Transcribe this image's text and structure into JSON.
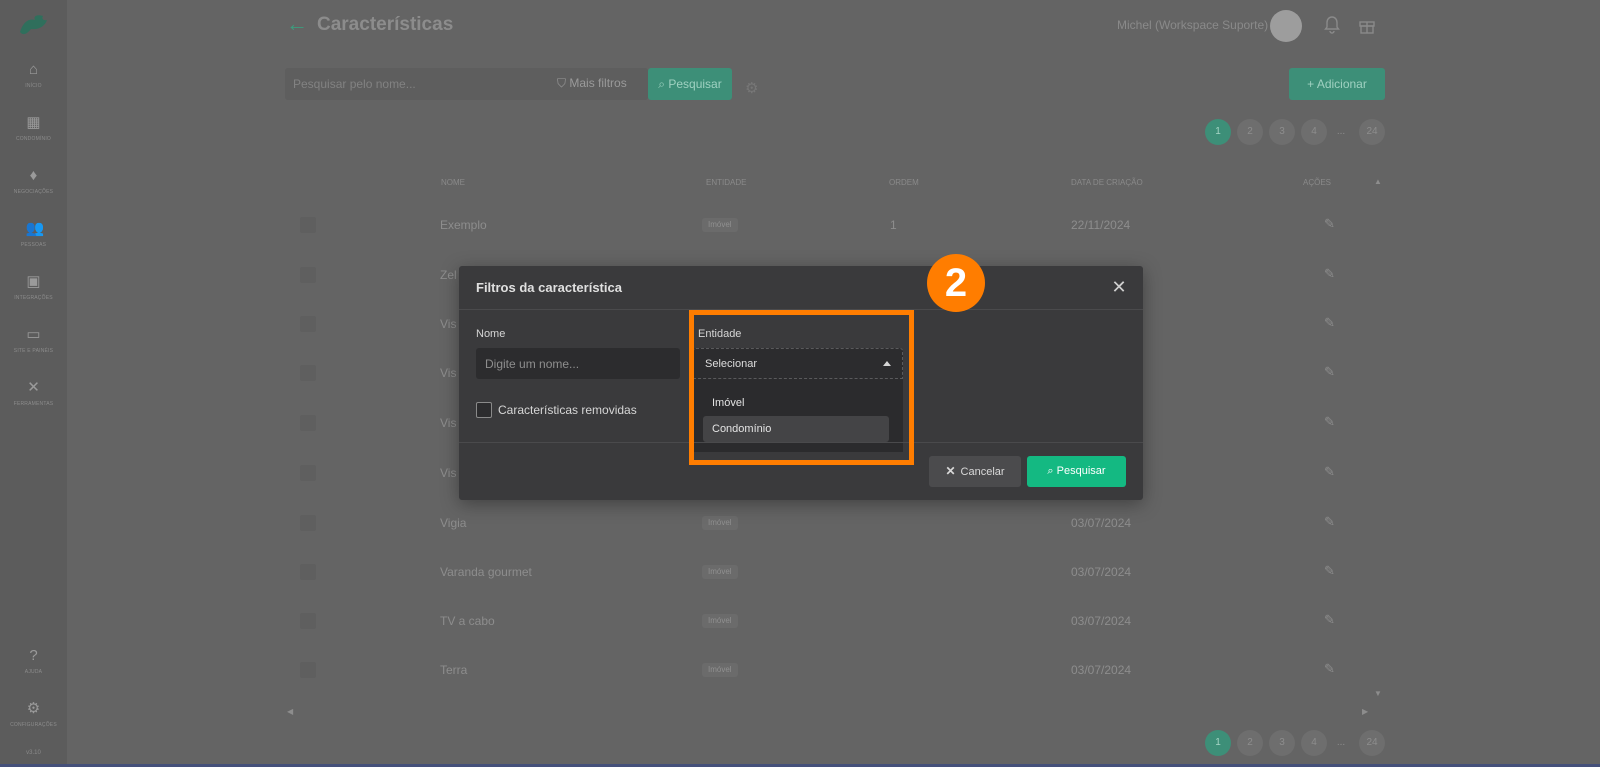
{
  "sidebar": {
    "items": [
      {
        "label": "INÍCIO",
        "icon": "home-icon"
      },
      {
        "label": "CONDOMÍNIO",
        "icon": "building-icon"
      },
      {
        "label": "NEGOCIAÇÕES",
        "icon": "diamond-icon"
      },
      {
        "label": "PESSOAS",
        "icon": "people-icon"
      },
      {
        "label": "INTEGRAÇÕES",
        "icon": "integrations-icon"
      },
      {
        "label": "SITE E PAINÉIS",
        "icon": "laptop-icon"
      },
      {
        "label": "FERRAMENTAS",
        "icon": "tools-icon"
      }
    ],
    "bottom_items": [
      {
        "label": "AJUDA",
        "icon": "help-icon"
      },
      {
        "label": "CONFIGURAÇÕES",
        "icon": "settings-icon"
      }
    ],
    "version": "v3.10"
  },
  "header": {
    "title": "Características",
    "user": "Michel (Workspace Suporte)"
  },
  "toolbar": {
    "search_placeholder": "Pesquisar pelo nome...",
    "more_filters": "Mais filtros",
    "search_button": "Pesquisar",
    "add_button": "+ Adicionar"
  },
  "pagination": {
    "pages": [
      "1",
      "2",
      "3",
      "4"
    ],
    "dots": "...",
    "last": "24",
    "active": "1"
  },
  "table": {
    "columns": [
      "NOME",
      "ENTIDADE",
      "ORDEM",
      "DATA DE CRIAÇÃO",
      "AÇÕES"
    ],
    "rows": [
      {
        "name": "Exemplo",
        "entity": "Imóvel",
        "order": "1",
        "date": "22/11/2024"
      },
      {
        "name": "Zel",
        "entity": "",
        "order": "",
        "date": ""
      },
      {
        "name": "Vis",
        "entity": "",
        "order": "",
        "date": ""
      },
      {
        "name": "Vis",
        "entity": "",
        "order": "",
        "date": ""
      },
      {
        "name": "Vis",
        "entity": "",
        "order": "",
        "date": ""
      },
      {
        "name": "Vis",
        "entity": "",
        "order": "",
        "date": ""
      },
      {
        "name": "Vigia",
        "entity": "Imóvel",
        "order": "",
        "date": "03/07/2024"
      },
      {
        "name": "Varanda gourmet",
        "entity": "Imóvel",
        "order": "",
        "date": "03/07/2024"
      },
      {
        "name": "TV a cabo",
        "entity": "Imóvel",
        "order": "",
        "date": "03/07/2024"
      },
      {
        "name": "Terra",
        "entity": "Imóvel",
        "order": "",
        "date": "03/07/2024"
      }
    ]
  },
  "modal": {
    "title": "Filtros da característica",
    "name_label": "Nome",
    "name_placeholder": "Digite um nome...",
    "entity_label": "Entidade",
    "entity_select_value": "Selecionar",
    "entity_options": [
      "Imóvel",
      "Condomínio"
    ],
    "hovered_option": "Condomínio",
    "removed_checkbox_label": "Características removidas",
    "removed_checked": false,
    "cancel_button": "Cancelar",
    "search_button": "Pesquisar"
  },
  "annotation": {
    "step_number": "2",
    "color": "#ff7d00"
  },
  "colors": {
    "primary": "#14b982",
    "overlay": "#646464",
    "modal_bg": "#3a3a3c"
  }
}
